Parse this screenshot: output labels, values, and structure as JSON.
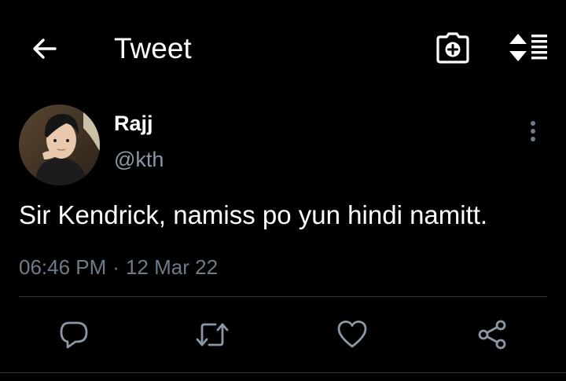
{
  "header": {
    "title": "Tweet",
    "back_icon": "arrow-left-icon",
    "camera_icon": "camera-add-icon",
    "sort_icon": "sort-list-icon"
  },
  "tweet": {
    "author_name": "Rajj",
    "author_handle": "@kth",
    "text": "Sir Kendrick, namiss po yun hindi namitt.",
    "time": "06:46 PM",
    "separator": "·",
    "date": "12 Mar 22"
  },
  "actions": {
    "reply_icon": "reply-icon",
    "retweet_icon": "retweet-icon",
    "like_icon": "heart-icon",
    "share_icon": "share-icon"
  },
  "colors": {
    "background": "#000000",
    "text": "#ffffff",
    "secondary": "#8b98a5",
    "action_icon": "#8b98a5",
    "divider": "#2f3336"
  }
}
